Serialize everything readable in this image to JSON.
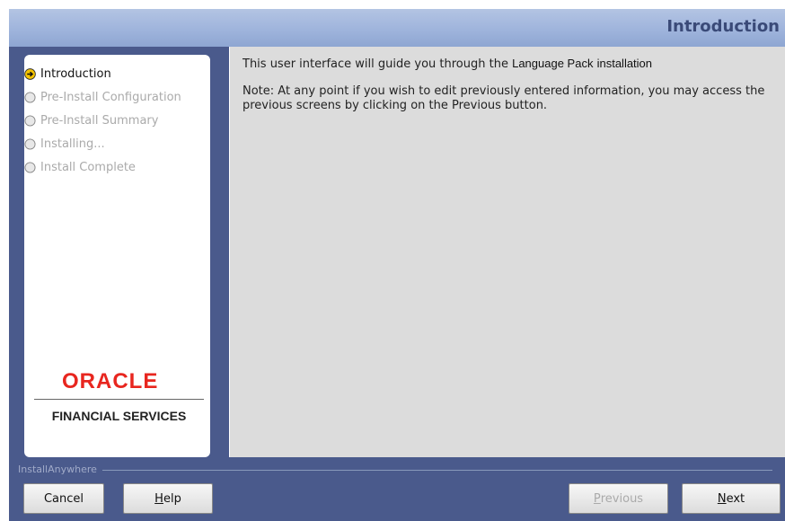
{
  "window": {
    "title": "Introduction"
  },
  "steps": [
    {
      "label": "Introduction",
      "state": "active"
    },
    {
      "label": "Pre-Install Configuration",
      "state": "pending"
    },
    {
      "label": "Pre-Install Summary",
      "state": "pending"
    },
    {
      "label": "Installing...",
      "state": "pending"
    },
    {
      "label": "Install Complete",
      "state": "pending"
    }
  ],
  "brand": {
    "logo_text": "ORACLE",
    "sub": "FINANCIAL SERVICES",
    "logo_color": "#e8261f"
  },
  "content": {
    "intro_prefix": "This user interface will guide you through the",
    "product": "Language Pack",
    "intro_suffix": "installation",
    "note": "Note: At any point if you wish to edit previously entered information, you may access the previous screens by clicking on the Previous button."
  },
  "footer": {
    "vendor": "InstallAnywhere",
    "cancel": "Cancel",
    "help_first": "H",
    "help_rest": "elp",
    "previous_first": "P",
    "previous_rest": "revious",
    "next_first": "N",
    "next_rest": "ext"
  },
  "colors": {
    "frame": "#4a5a8c",
    "titlebar": "#9fb4dc",
    "content_bg": "#dcdcdc",
    "active_step_icon": "#f5c400"
  }
}
